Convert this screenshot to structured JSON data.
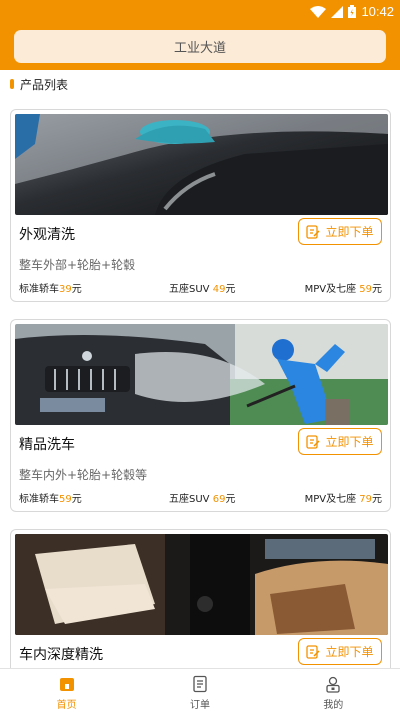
{
  "status_bar": {
    "time": "10:42"
  },
  "header": {
    "search_text": "工业大道"
  },
  "section": {
    "title": "产品列表"
  },
  "products": [
    {
      "name": "外观清洗",
      "description": "整车外部+轮胎+轮毂",
      "order_label": "立即下单",
      "prices": [
        {
          "label": "标准轿车",
          "value": "39",
          "unit": "元"
        },
        {
          "label": "五座SUV",
          "value": "49",
          "unit": "元"
        },
        {
          "label": "MPV及七座",
          "value": "59",
          "unit": "元"
        }
      ]
    },
    {
      "name": "精品洗车",
      "description": "整车内外+轮胎+轮毂等",
      "order_label": "立即下单",
      "prices": [
        {
          "label": "标准轿车",
          "value": "59",
          "unit": "元"
        },
        {
          "label": "五座SUV",
          "value": "69",
          "unit": "元"
        },
        {
          "label": "MPV及七座",
          "value": "79",
          "unit": "元"
        }
      ]
    },
    {
      "name": "车内深度精洗",
      "order_label": "立即下单"
    }
  ],
  "bottom_nav": {
    "tabs": [
      {
        "label": "首页",
        "icon": "home-icon",
        "active": true
      },
      {
        "label": "订单",
        "icon": "order-icon",
        "active": false
      },
      {
        "label": "我的",
        "icon": "profile-icon",
        "active": false
      }
    ]
  },
  "colors": {
    "accent": "#f39200",
    "search_bg": "#fcebd6"
  }
}
